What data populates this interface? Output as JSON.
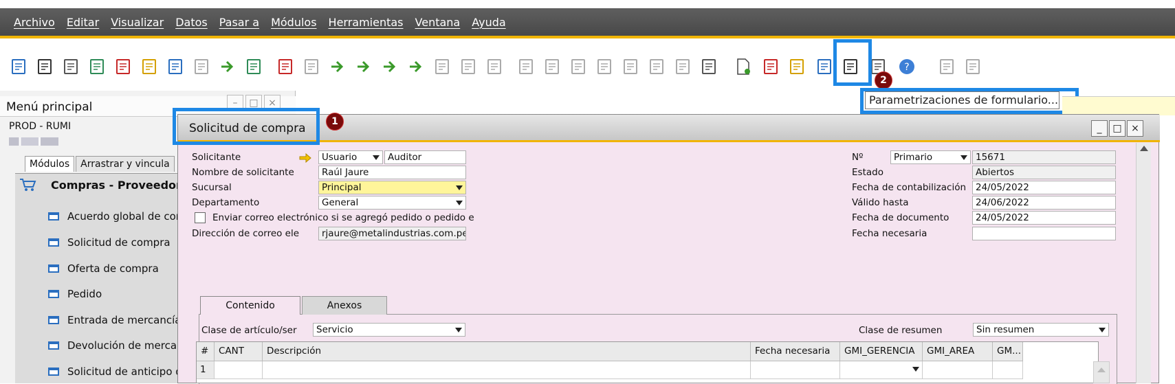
{
  "menu": [
    "Archivo",
    "Editar",
    "Visualizar",
    "Datos",
    "Pasar a",
    "Módulos",
    "Herramientas",
    "Ventana",
    "Ayuda"
  ],
  "toolbar": {
    "tooltip": "Parametrizaciones de formulario...",
    "badge2": "2",
    "icons": [
      "preview-icon",
      "print-icon",
      "email-icon",
      "sms-icon",
      "fax-icon",
      "export-excel-icon",
      "export-word-icon",
      "export-pdf-icon",
      "navigate-icon",
      "lock-icon",
      "find-icon",
      "list-icon",
      "first-record-icon",
      "previous-record-icon",
      "next-record-icon",
      "last-record-icon",
      "refresh-icon",
      "filter-icon",
      "sort-icon",
      "base-document-icon",
      "target-document-icon",
      "gross-profit-icon",
      "volume-weight-icon",
      "layout-designer-icon",
      "payment-means-icon",
      "relationship-map-icon",
      "edit-icon",
      "form-settings-icon",
      "query-icon",
      "calendar-icon",
      "messages-icon",
      "dashboard-icon",
      "hierarchy-icon",
      "help-icon",
      "settings-a-icon",
      "settings-b-icon"
    ]
  },
  "leftpanel": {
    "title": "Menú principal",
    "db": "PROD - RUMI",
    "tabs": [
      "Módulos",
      "Arrastrar y vincula"
    ],
    "module": "Compras - Proveedor",
    "items": [
      "Acuerdo global de cor",
      "Solicitud de compra",
      "Oferta de compra",
      "Pedido",
      "Entrada de mercancía",
      "Devolución de mercar",
      "Solicitud de anticipo d"
    ]
  },
  "form": {
    "title": "Solicitud de compra",
    "badge1": "1",
    "left": {
      "solicitante_lbl": "Solicitante",
      "solicitante_tipo": "Usuario",
      "solicitante_val": "Auditor",
      "nombre_lbl": "Nombre de solicitante",
      "nombre_val": "Raúl Jaure",
      "sucursal_lbl": "Sucursal",
      "sucursal_val": "Principal",
      "depto_lbl": "Departamento",
      "depto_val": "General",
      "email_chk_lbl": "Enviar correo electrónico si se agregó pedido o pedido e",
      "email_lbl": "Dirección de correo ele",
      "email_val": "rjaure@metalindustrias.com.pe"
    },
    "right": {
      "no_lbl": "Nº",
      "serie_val": "Primario",
      "no_val": "15671",
      "estado_lbl": "Estado",
      "estado_val": "Abiertos",
      "fcont_lbl": "Fecha de contabilización",
      "fcont_val": "24/05/2022",
      "valido_lbl": "Válido hasta",
      "valido_val": "24/06/2022",
      "fdoc_lbl": "Fecha de documento",
      "fdoc_val": "24/05/2022",
      "fnec_lbl": "Fecha necesaria",
      "fnec_val": ""
    },
    "tabs": [
      "Contenido",
      "Anexos"
    ],
    "clase_lbl": "Clase de artículo/ser",
    "clase_val": "Servicio",
    "resumen_lbl": "Clase de resumen",
    "resumen_val": "Sin resumen",
    "grid": {
      "headers": [
        "#",
        "CANT",
        "Descripción",
        "Fecha necesaria",
        "GMI_GERENCIA",
        "GMI_AREA",
        "GM..."
      ],
      "row1": [
        "1",
        "",
        "",
        "",
        "",
        "",
        ""
      ]
    }
  }
}
